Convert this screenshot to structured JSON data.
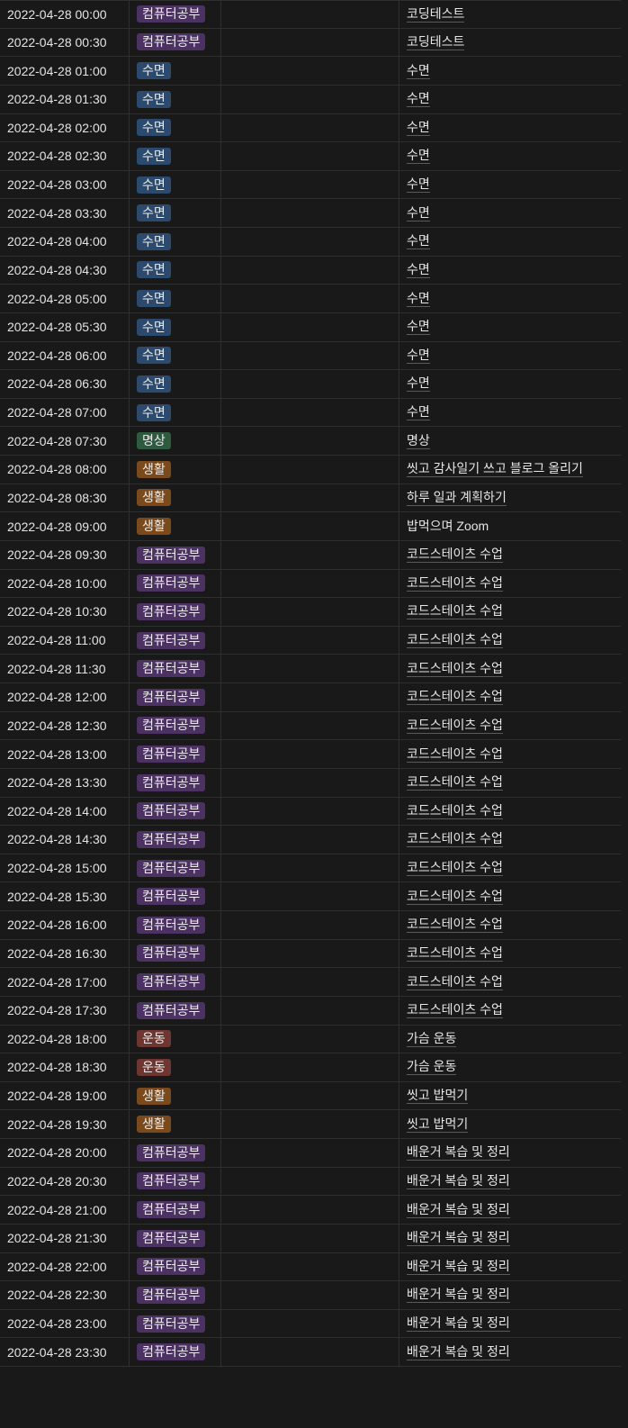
{
  "colors": {
    "컴퓨터공부": "#4b3263",
    "수면": "#2b4a6e",
    "명상": "#2e5b40",
    "생활": "#7a4a1c",
    "운동": "#6e3630"
  },
  "rows": [
    {
      "time": "2022-04-28 00:00",
      "category": "컴퓨터공부",
      "desc": "코딩테스트"
    },
    {
      "time": "2022-04-28 00:30",
      "category": "컴퓨터공부",
      "desc": "코딩테스트"
    },
    {
      "time": "2022-04-28 01:00",
      "category": "수면",
      "desc": "수면"
    },
    {
      "time": "2022-04-28 01:30",
      "category": "수면",
      "desc": "수면"
    },
    {
      "time": "2022-04-28 02:00",
      "category": "수면",
      "desc": "수면"
    },
    {
      "time": "2022-04-28 02:30",
      "category": "수면",
      "desc": "수면"
    },
    {
      "time": "2022-04-28 03:00",
      "category": "수면",
      "desc": "수면"
    },
    {
      "time": "2022-04-28 03:30",
      "category": "수면",
      "desc": "수면"
    },
    {
      "time": "2022-04-28 04:00",
      "category": "수면",
      "desc": "수면"
    },
    {
      "time": "2022-04-28 04:30",
      "category": "수면",
      "desc": "수면"
    },
    {
      "time": "2022-04-28 05:00",
      "category": "수면",
      "desc": "수면"
    },
    {
      "time": "2022-04-28 05:30",
      "category": "수면",
      "desc": "수면"
    },
    {
      "time": "2022-04-28 06:00",
      "category": "수면",
      "desc": "수면"
    },
    {
      "time": "2022-04-28 06:30",
      "category": "수면",
      "desc": "수면"
    },
    {
      "time": "2022-04-28 07:00",
      "category": "수면",
      "desc": "수면"
    },
    {
      "time": "2022-04-28 07:30",
      "category": "명상",
      "desc": "명상"
    },
    {
      "time": "2022-04-28 08:00",
      "category": "생활",
      "desc": "씻고 감사일기 쓰고 블로그 올리기"
    },
    {
      "time": "2022-04-28 08:30",
      "category": "생활",
      "desc": "하루 일과 계획하기"
    },
    {
      "time": "2022-04-28 09:00",
      "category": "생활",
      "desc": "밥먹으며 Zoom",
      "plain": true
    },
    {
      "time": "2022-04-28 09:30",
      "category": "컴퓨터공부",
      "desc": "코드스테이츠 수업"
    },
    {
      "time": "2022-04-28 10:00",
      "category": "컴퓨터공부",
      "desc": "코드스테이츠 수업"
    },
    {
      "time": "2022-04-28 10:30",
      "category": "컴퓨터공부",
      "desc": "코드스테이츠 수업"
    },
    {
      "time": "2022-04-28 11:00",
      "category": "컴퓨터공부",
      "desc": "코드스테이츠 수업"
    },
    {
      "time": "2022-04-28 11:30",
      "category": "컴퓨터공부",
      "desc": "코드스테이츠 수업"
    },
    {
      "time": "2022-04-28 12:00",
      "category": "컴퓨터공부",
      "desc": "코드스테이츠 수업"
    },
    {
      "time": "2022-04-28 12:30",
      "category": "컴퓨터공부",
      "desc": "코드스테이츠 수업"
    },
    {
      "time": "2022-04-28 13:00",
      "category": "컴퓨터공부",
      "desc": "코드스테이츠 수업"
    },
    {
      "time": "2022-04-28 13:30",
      "category": "컴퓨터공부",
      "desc": "코드스테이츠 수업"
    },
    {
      "time": "2022-04-28 14:00",
      "category": "컴퓨터공부",
      "desc": "코드스테이츠 수업"
    },
    {
      "time": "2022-04-28 14:30",
      "category": "컴퓨터공부",
      "desc": "코드스테이츠 수업"
    },
    {
      "time": "2022-04-28 15:00",
      "category": "컴퓨터공부",
      "desc": "코드스테이츠 수업"
    },
    {
      "time": "2022-04-28 15:30",
      "category": "컴퓨터공부",
      "desc": "코드스테이츠 수업"
    },
    {
      "time": "2022-04-28 16:00",
      "category": "컴퓨터공부",
      "desc": "코드스테이츠 수업"
    },
    {
      "time": "2022-04-28 16:30",
      "category": "컴퓨터공부",
      "desc": "코드스테이츠 수업"
    },
    {
      "time": "2022-04-28 17:00",
      "category": "컴퓨터공부",
      "desc": "코드스테이츠 수업"
    },
    {
      "time": "2022-04-28 17:30",
      "category": "컴퓨터공부",
      "desc": "코드스테이츠 수업"
    },
    {
      "time": "2022-04-28 18:00",
      "category": "운동",
      "desc": "가슴 운동"
    },
    {
      "time": "2022-04-28 18:30",
      "category": "운동",
      "desc": "가슴 운동"
    },
    {
      "time": "2022-04-28 19:00",
      "category": "생활",
      "desc": "씻고 밥먹기"
    },
    {
      "time": "2022-04-28 19:30",
      "category": "생활",
      "desc": "씻고 밥먹기"
    },
    {
      "time": "2022-04-28 20:00",
      "category": "컴퓨터공부",
      "desc": "배운거 복습 및 정리"
    },
    {
      "time": "2022-04-28 20:30",
      "category": "컴퓨터공부",
      "desc": "배운거 복습 및 정리"
    },
    {
      "time": "2022-04-28 21:00",
      "category": "컴퓨터공부",
      "desc": "배운거 복습 및 정리"
    },
    {
      "time": "2022-04-28 21:30",
      "category": "컴퓨터공부",
      "desc": "배운거 복습 및 정리"
    },
    {
      "time": "2022-04-28 22:00",
      "category": "컴퓨터공부",
      "desc": "배운거 복습 및 정리"
    },
    {
      "time": "2022-04-28 22:30",
      "category": "컴퓨터공부",
      "desc": "배운거 복습 및 정리"
    },
    {
      "time": "2022-04-28 23:00",
      "category": "컴퓨터공부",
      "desc": "배운거 복습 및 정리"
    },
    {
      "time": "2022-04-28 23:30",
      "category": "컴퓨터공부",
      "desc": "배운거 복습 및 정리"
    }
  ]
}
